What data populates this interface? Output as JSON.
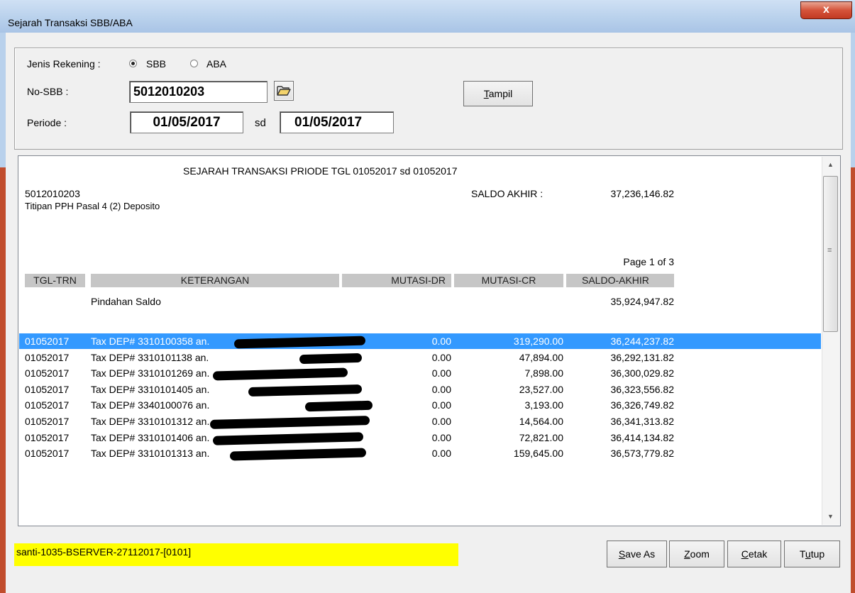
{
  "window": {
    "title": "Sejarah Transaksi SBB/ABA",
    "close_glyph": "x"
  },
  "criteria": {
    "jenis_label": "Jenis Rekening :",
    "radio_sbb": "SBB",
    "radio_aba": "ABA",
    "selected": "SBB",
    "no_label": "No-SBB :",
    "no_value": "5012010203",
    "periode_label": "Periode :",
    "date_from": "01/05/2017",
    "sd": "sd",
    "date_to": "01/05/2017",
    "tampil_first": "T",
    "tampil_rest": "ampil"
  },
  "report": {
    "heading": "SEJARAH TRANSAKSI PRIODE TGL 01052017 sd 01052017",
    "account_no": "5012010203",
    "account_name": "Titipan PPH Pasal 4 (2) Deposito",
    "saldo_akhir_label": "SALDO AKHIR :",
    "saldo_akhir_value": "37,236,146.82",
    "page": "Page 1 of 3",
    "columns": [
      "TGL-TRN",
      "KETERANGAN",
      "MUTASI-DR",
      "MUTASI-CR",
      "SALDO-AKHIR"
    ],
    "opening_desc": "Pindahan Saldo",
    "opening_saldo": "35,924,947.82",
    "rows": [
      {
        "tgl": "01052017",
        "ket": "Tax DEP# 3310100358 an.",
        "dr": "0.00",
        "cr": "319,290.00",
        "saldo": "36,244,237.82"
      },
      {
        "tgl": "01052017",
        "ket": "Tax DEP# 3310101138 an.",
        "dr": "0.00",
        "cr": "47,894.00",
        "saldo": "36,292,131.82"
      },
      {
        "tgl": "01052017",
        "ket": "Tax DEP# 3310101269 an.",
        "dr": "0.00",
        "cr": "7,898.00",
        "saldo": "36,300,029.82"
      },
      {
        "tgl": "01052017",
        "ket": "Tax DEP# 3310101405 an.",
        "dr": "0.00",
        "cr": "23,527.00",
        "saldo": "36,323,556.82"
      },
      {
        "tgl": "01052017",
        "ket": "Tax DEP# 3340100076 an.",
        "dr": "0.00",
        "cr": "3,193.00",
        "saldo": "36,326,749.82"
      },
      {
        "tgl": "01052017",
        "ket": "Tax DEP# 3310101312 an.",
        "dr": "0.00",
        "cr": "14,564.00",
        "saldo": "36,341,313.82"
      },
      {
        "tgl": "01052017",
        "ket": "Tax DEP# 3310101406 an.",
        "dr": "0.00",
        "cr": "72,821.00",
        "saldo": "36,414,134.82"
      },
      {
        "tgl": "01052017",
        "ket": "Tax DEP# 3310101313 an.",
        "dr": "0.00",
        "cr": "159,645.00",
        "saldo": "36,573,779.82"
      }
    ]
  },
  "status": {
    "text": "santi-1035-BSERVER-27112017-[0101]"
  },
  "buttons": {
    "save_first": "S",
    "save_rest": "ave As",
    "zoom_first": "Z",
    "zoom_rest": "oom",
    "cetak_first": "C",
    "cetak_rest": "etak",
    "tutup_pre": "T",
    "tutup_key": "u",
    "tutup_rest": "tup"
  },
  "colors": {
    "selection": "#3399ff",
    "status_bg": "#ffff00",
    "header_bg": "#c6c6c6"
  }
}
